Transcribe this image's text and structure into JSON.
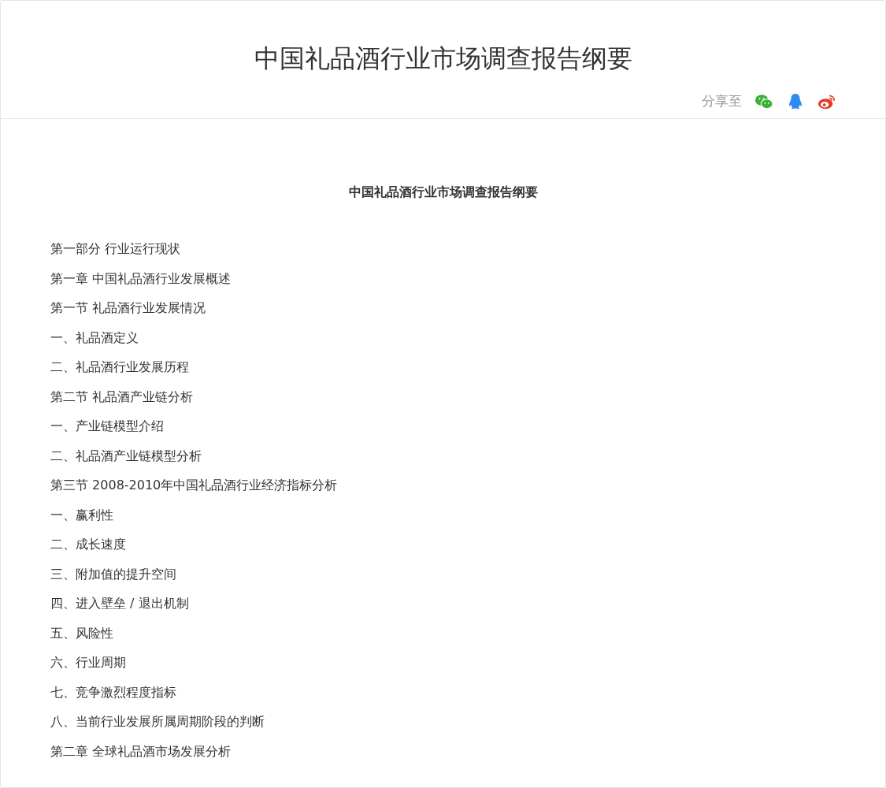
{
  "page": {
    "title": "中国礼品酒行业市场调查报告纲要",
    "share": {
      "label": "分享至",
      "targets": [
        {
          "kind": "wechat"
        },
        {
          "kind": "qq"
        },
        {
          "kind": "weibo"
        }
      ]
    }
  },
  "article": {
    "heading": "中国礼品酒行业市场调查报告纲要",
    "lines": [
      "第一部分 行业运行现状",
      "第一章 中国礼品酒行业发展概述",
      "第一节 礼品酒行业发展情况",
      "一、礼品酒定义",
      "二、礼品酒行业发展历程",
      "第二节 礼品酒产业链分析",
      "一、产业链模型介绍",
      "二、礼品酒产业链模型分析",
      "第三节 2008-2010年中国礼品酒行业经济指标分析",
      "一、赢利性",
      "二、成长速度",
      "三、附加值的提升空间",
      "四、进入壁垒 / 退出机制",
      "五、风险性",
      "六、行业周期",
      "七、竞争激烈程度指标",
      "八、当前行业发展所属周期阶段的判断",
      "第二章 全球礼品酒市场发展分析"
    ]
  }
}
